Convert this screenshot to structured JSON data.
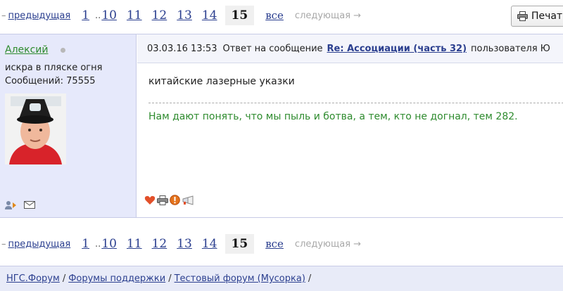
{
  "pager": {
    "prev_label": "предыдущая",
    "pages": [
      "1",
      "10",
      "11",
      "12",
      "13",
      "14"
    ],
    "gap": "..",
    "current": "15",
    "all_label": "все",
    "next_label": "следующая →"
  },
  "print_label": "Печать",
  "post": {
    "author": {
      "name": "Алексий",
      "title": "искра в пляске огня",
      "posts_label": "Сообщений: 75555"
    },
    "header": {
      "date": "03.03.16 13:53",
      "reply_label": "Ответ на сообщение",
      "reply_link": "Re: Ассоциации (часть 32)",
      "reply_suffix": "пользователя Ю"
    },
    "text": "китайские лазерные указки",
    "signature": "Нам дают понять, что мы пыль и ботва, а тем, кто не догнал, тем 282."
  },
  "breadcrumb": {
    "items": [
      "НГС.Форум",
      "Форумы поддержки",
      "Тестовый форум (Мусорка)"
    ],
    "separator": "/"
  },
  "colors": {
    "link": "#2b3f8f",
    "author_green": "#2e8b2e",
    "author_panel_bg": "#e6e9fb"
  }
}
